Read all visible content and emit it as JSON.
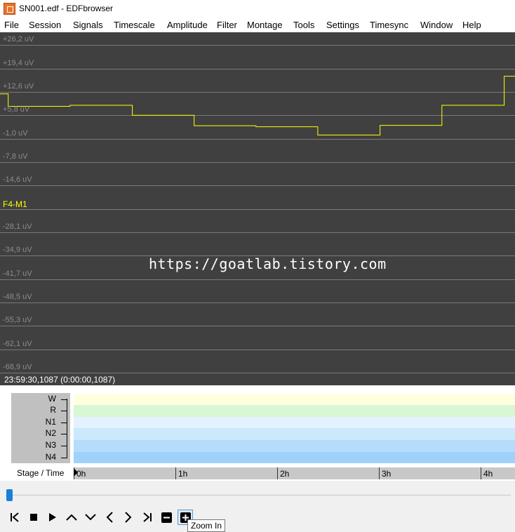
{
  "window": {
    "title": "SN001.edf - EDFbrowser",
    "icon": "edfbrowser-app-icon"
  },
  "menubar": [
    "File",
    "Session",
    "Signals",
    "Timescale",
    "Amplitude",
    "Filter",
    "Montage",
    "Tools",
    "Settings",
    "Timesync",
    "Window",
    "Help"
  ],
  "signal": {
    "name": "F4-M1",
    "color": "#ffff00",
    "axis_labels": [
      "+26,2 uV",
      "+19,4 uV",
      "+12,6 uV",
      "+5,8 uV",
      "-1,0 uV",
      "-7,8 uV",
      "-14,6 uV",
      "F4-M1",
      "-28,1 uV",
      "-34,9 uV",
      "-41,7 uV",
      "-48,5 uV",
      "-55,3 uV",
      "-62,1 uV",
      "-68,9 uV"
    ],
    "trace_uV": [
      {
        "t0": 0,
        "t1": 0.016,
        "v": 9.2
      },
      {
        "t0": 0.016,
        "t1": 0.136,
        "v": 5.6
      },
      {
        "t0": 0.136,
        "t1": 0.257,
        "v": 5.9
      },
      {
        "t0": 0.257,
        "t1": 0.377,
        "v": 3.0
      },
      {
        "t0": 0.377,
        "t1": 0.497,
        "v": 0.0
      },
      {
        "t0": 0.497,
        "t1": 0.617,
        "v": -0.3
      },
      {
        "t0": 0.617,
        "t1": 0.738,
        "v": -2.7
      },
      {
        "t0": 0.738,
        "t1": 0.858,
        "v": 0.1
      },
      {
        "t0": 0.858,
        "t1": 0.979,
        "v": 5.9
      },
      {
        "t0": 0.979,
        "t1": 1.0,
        "v": 14.3
      }
    ]
  },
  "watermark": "https://goatlab.tistory.com",
  "status": {
    "time": "23:59:30,1087 (0:00:00,1087)"
  },
  "hypnogram": {
    "stages": [
      "W",
      "R",
      "N1",
      "N2",
      "N3",
      "N4"
    ],
    "stage_colors": [
      "#ffffe0",
      "#d9f7d4",
      "#e4f2ff",
      "#cce8fd",
      "#b5dcfb",
      "#9fd2fa"
    ],
    "caption": "Stage / Time",
    "time_labels": [
      "0h",
      "1h",
      "2h",
      "3h",
      "4h"
    ]
  },
  "scrollbar": {
    "position": 0.0
  },
  "toolbar": {
    "buttons": [
      {
        "name": "go-to-start-button",
        "icon": "skip-start-icon"
      },
      {
        "name": "stop-button",
        "icon": "stop-icon"
      },
      {
        "name": "play-button",
        "icon": "play-icon"
      },
      {
        "name": "page-up-button",
        "icon": "chevron-up-icon"
      },
      {
        "name": "page-down-button",
        "icon": "chevron-down-icon"
      },
      {
        "name": "previous-page-button",
        "icon": "chevron-left-icon"
      },
      {
        "name": "next-page-button",
        "icon": "chevron-right-icon"
      },
      {
        "name": "go-to-end-button",
        "icon": "skip-end-icon"
      },
      {
        "name": "zoom-out-button",
        "icon": "minus-icon"
      },
      {
        "name": "zoom-in-button",
        "icon": "plus-icon"
      }
    ],
    "tooltip": "Zoom In"
  }
}
